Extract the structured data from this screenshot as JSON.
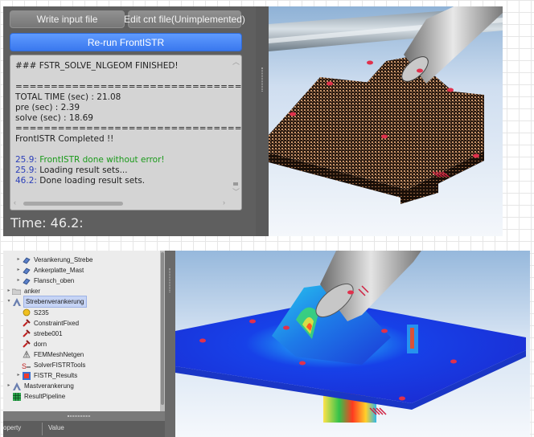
{
  "fem_panel": {
    "write_input_button": "Write input file",
    "edit_cnt_button": "Edit cnt file(Unimplemented)",
    "rerun_button": "Re-run FrontISTR",
    "console": {
      "lines": [
        {
          "ts": "",
          "text": "### FSTR_SOLVE_NLGEOM FINISHED!"
        },
        {
          "ts": "",
          "text": ""
        },
        {
          "ts": "",
          "text": "================================"
        },
        {
          "ts": "",
          "text": "TOTAL TIME (sec) : 21.08"
        },
        {
          "ts": "",
          "text": "pre (sec) : 2.39"
        },
        {
          "ts": "",
          "text": "solve (sec) : 18.69"
        },
        {
          "ts": "",
          "text": "================================"
        },
        {
          "ts": "",
          "text": "FrontISTR Completed !!"
        },
        {
          "ts": "",
          "text": ""
        },
        {
          "ts": "25.9:",
          "text": "FrontISTR done without error!"
        },
        {
          "ts": "25.9:",
          "text": "Loading result sets..."
        },
        {
          "ts": "46.2:",
          "text": "Done loading result sets."
        }
      ]
    },
    "time_label": "Time: 46.2:"
  },
  "tree": {
    "items": [
      {
        "label": "Verankerung_Strebe",
        "indent": 2,
        "icon": "part-icon",
        "expand": "▸"
      },
      {
        "label": "Ankerplatte_Mast",
        "indent": 2,
        "icon": "part-icon",
        "expand": "▸"
      },
      {
        "label": "Flansch_oben",
        "indent": 2,
        "icon": "part-icon",
        "expand": "▸"
      },
      {
        "label": "anker",
        "indent": 1,
        "icon": "folder-icon",
        "expand": "▸"
      },
      {
        "label": "Strebenverankerung",
        "indent": 1,
        "icon": "analysis-icon",
        "expand": "▾",
        "selected": true
      },
      {
        "label": "S235",
        "indent": 2,
        "icon": "material-icon",
        "expand": ""
      },
      {
        "label": "ConstraintFixed",
        "indent": 2,
        "icon": "constraint-icon",
        "expand": ""
      },
      {
        "label": "strebe001",
        "indent": 2,
        "icon": "constraint-icon",
        "expand": ""
      },
      {
        "label": "dorn",
        "indent": 2,
        "icon": "constraint-icon",
        "expand": ""
      },
      {
        "label": "FEMMeshNetgen",
        "indent": 2,
        "icon": "mesh-icon",
        "expand": ""
      },
      {
        "label": "SolverFISTRTools",
        "indent": 2,
        "icon": "solver-icon",
        "expand": ""
      },
      {
        "label": "FISTR_Results",
        "indent": 2,
        "icon": "results-icon",
        "expand": "▸"
      },
      {
        "label": "Mastverankerung",
        "indent": 1,
        "icon": "analysis-icon",
        "expand": "▸"
      },
      {
        "label": "ResultPipeline",
        "indent": 1,
        "icon": "pipeline-icon",
        "expand": ""
      }
    ]
  },
  "property_panel": {
    "col_property": "operty",
    "col_value": "Value"
  }
}
